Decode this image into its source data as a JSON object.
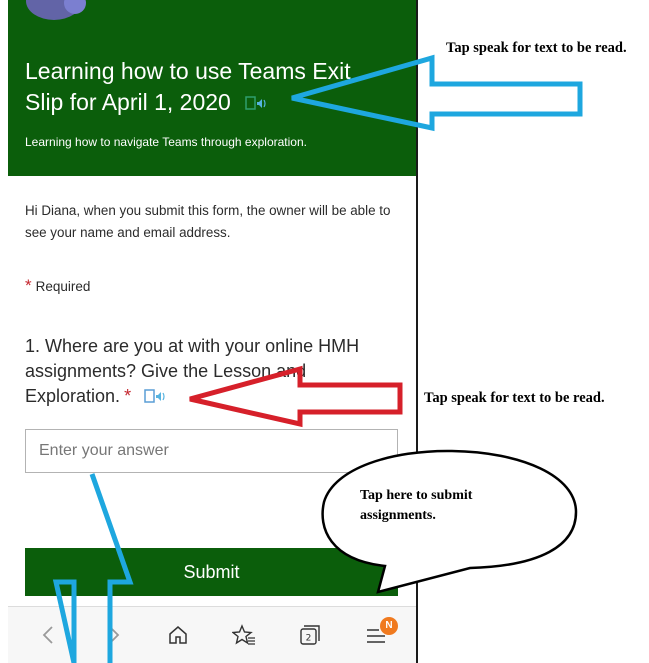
{
  "form": {
    "title": "Learning how to use Teams Exit Slip for April 1, 2020",
    "subtitle": "Learning how to navigate Teams through exploration.",
    "notice": "Hi Diana, when you submit this form, the owner will be able to see your name and email address.",
    "required_star": "*",
    "required_label": "Required",
    "question_text": "1. Where are you at with your online HMH assignments? Give the Lesson and Exploration.",
    "question_star": "*",
    "answer_placeholder": "Enter your answer",
    "submit_label": "Submit"
  },
  "browser_bar": {
    "items": [
      "back-icon",
      "forward-icon",
      "home-icon",
      "favorites-icon",
      "tabs-icon",
      "menu-icon"
    ],
    "tabs_count": "2",
    "profile_badge": "N"
  },
  "annotations": {
    "title_note": "Tap speak for text to be read.",
    "question_note": "Tap speak for text to be read.",
    "submit_note": "Tap here to submit assignments."
  },
  "colors": {
    "header_green": "#0b5e0b",
    "required_red": "#c4262e",
    "arrow_blue": "#1ea7df",
    "arrow_red": "#d6202a",
    "badge_orange": "#f07a1f"
  }
}
